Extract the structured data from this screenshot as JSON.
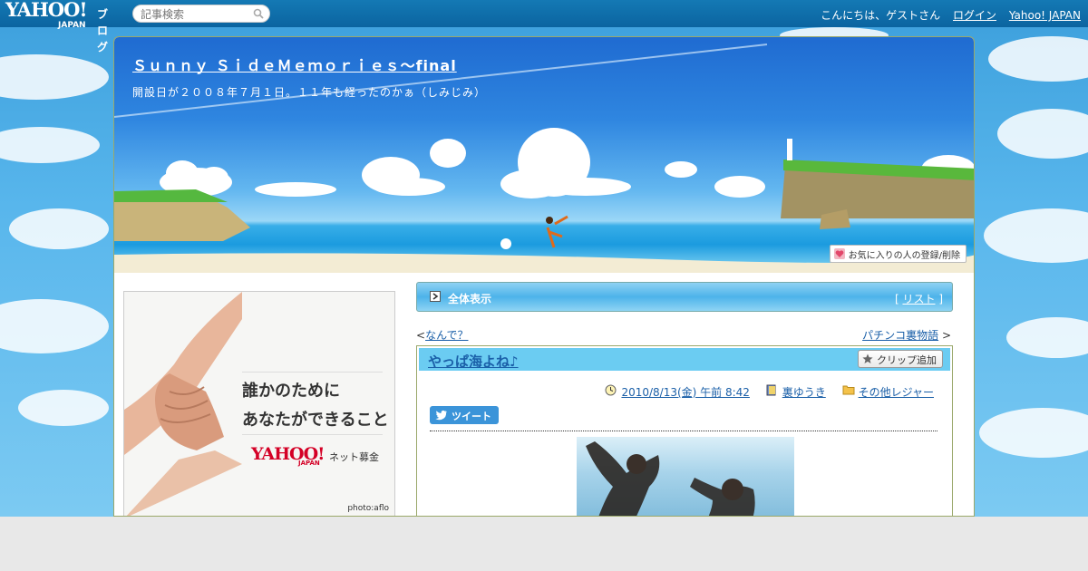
{
  "topbar": {
    "logo": "YAHOO!",
    "logo_sub": "JAPAN",
    "logo_blog": "ブログ",
    "search_placeholder": "記事検索",
    "greeting": "こんにちは、ゲストさん",
    "login": "ログイン",
    "yahoo_japan": "Yahoo! JAPAN"
  },
  "header": {
    "blog_title": "Ｓｕｎｎｙ ＳｉｄｅＭｅｍｏｒｉｅｓ～final",
    "description": "開設日が２００８年７月１日。１１年も経ったのかぁ（しみじみ）",
    "fav_button": "お気に入りの人の登録/削除"
  },
  "ad": {
    "line1": "誰かのために",
    "line2": "あなたができること",
    "logo": "YAHOO!",
    "logo_sub": "JAPAN",
    "label": "ネット募金",
    "credit": "photo:aflo"
  },
  "allview": {
    "label": "全体表示",
    "list_open": "[",
    "list_link": "リスト",
    "list_close": "]"
  },
  "pager": {
    "prev_arrow": "<",
    "prev": "なんで？",
    "next": "パチンコ裏物語",
    "next_arrow": ">"
  },
  "article": {
    "title": "やっぱ海よね♪",
    "clip_button": "クリップ追加",
    "date": "2010/8/13(金) 午前 8:42",
    "author": "裏ゆうき",
    "category": "その他レジャー",
    "tweet": "ツイート"
  },
  "colors": {
    "topbar": "#0b64a0",
    "link": "#1a5fa8",
    "article_head": "#6bccf2"
  }
}
